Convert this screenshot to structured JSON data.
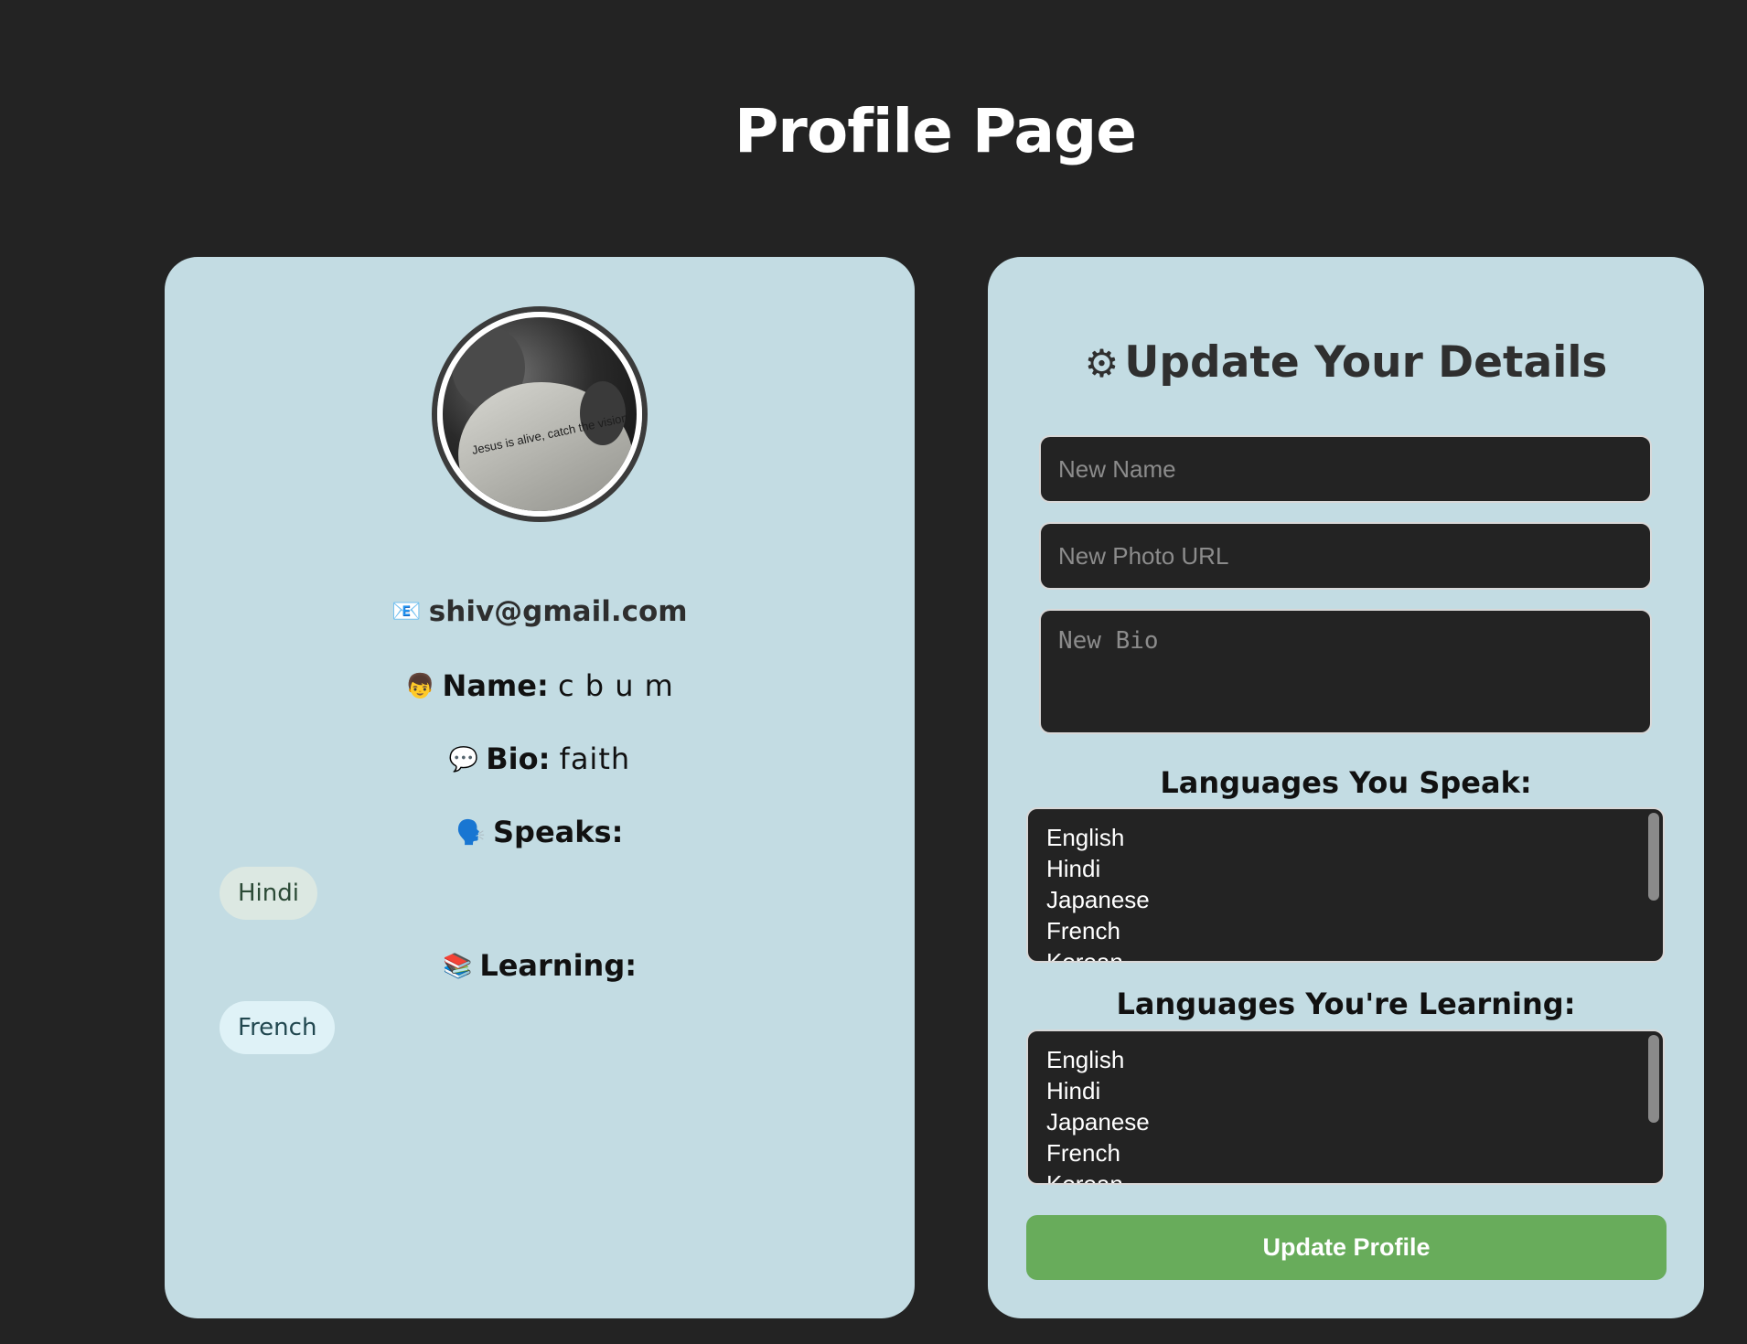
{
  "page": {
    "title": "Profile Page"
  },
  "profile": {
    "avatar_caption": "Jesus is alive, catch the vision",
    "email_icon": "📧",
    "email": "shiv@gmail.com",
    "name_icon": "👦",
    "name_label": "Name:",
    "name_value": "c b u m",
    "bio_icon": "💬",
    "bio_label": "Bio:",
    "bio_value": "faith",
    "speaks_icon": "🗣️",
    "speaks_label": "Speaks:",
    "speaks": [
      "Hindi"
    ],
    "learning_icon": "📚",
    "learning_label": "Learning:",
    "learning": [
      "French"
    ]
  },
  "update_form": {
    "title_icon": "⚙",
    "title": "Update Your Details",
    "name_placeholder": "New Name",
    "photo_placeholder": "New Photo URL",
    "bio_placeholder": "New Bio",
    "speak_label": "Languages You Speak:",
    "learn_label": "Languages You're Learning:",
    "language_options": [
      "English",
      "Hindi",
      "Japanese",
      "French",
      "Korean"
    ],
    "submit_label": "Update Profile"
  },
  "colors": {
    "background": "#232323",
    "card": "#c3dce3",
    "button": "#68ac5b",
    "speak_tag": "#dce8e2",
    "learn_tag": "#dff2f7"
  }
}
